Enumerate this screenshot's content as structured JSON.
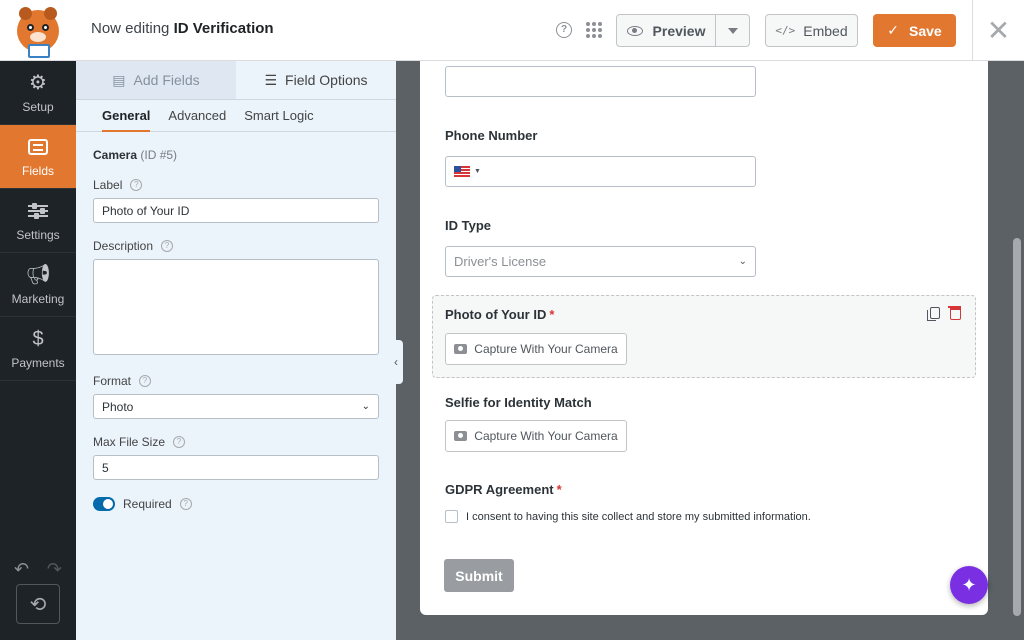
{
  "header": {
    "title_prefix": "Now editing",
    "title_form": "ID Verification",
    "preview_label": "Preview",
    "embed_label": "Embed",
    "save_label": "Save"
  },
  "sidebar": {
    "items": [
      {
        "label": "Setup",
        "icon": "gear-icon"
      },
      {
        "label": "Fields",
        "icon": "fields-icon",
        "active": true
      },
      {
        "label": "Settings",
        "icon": "sliders-icon"
      },
      {
        "label": "Marketing",
        "icon": "megaphone-icon"
      },
      {
        "label": "Payments",
        "icon": "dollar-icon"
      }
    ]
  },
  "panel": {
    "tabs": [
      {
        "label": "Add Fields"
      },
      {
        "label": "Field Options",
        "active": true
      }
    ],
    "subtabs": [
      {
        "label": "General",
        "active": true
      },
      {
        "label": "Advanced"
      },
      {
        "label": "Smart Logic"
      }
    ],
    "field_type": "Camera",
    "field_id": "(ID #5)",
    "label_caption": "Label",
    "label_value": "Photo of Your ID",
    "description_caption": "Description",
    "description_value": "",
    "format_caption": "Format",
    "format_value": "Photo",
    "max_file_size_caption": "Max File Size",
    "max_file_size_value": "5",
    "required_caption": "Required",
    "required_on": true
  },
  "form": {
    "phone_label": "Phone Number",
    "id_type_label": "ID Type",
    "id_type_placeholder": "Driver's License",
    "photo_label": "Photo of Your ID",
    "capture_label": "Capture With Your Camera",
    "selfie_label": "Selfie for Identity Match",
    "gdpr_label": "GDPR Agreement",
    "gdpr_text": "I consent to having this site collect and store my submitted information.",
    "required_mark": "*",
    "submit_label": "Submit"
  },
  "colors": {
    "accent": "#e27730",
    "sidebar_bg": "#1d2327",
    "panel_bg": "#ebf3fb",
    "ai_button": "#7a30e2",
    "toggle_on": "#036aab"
  }
}
